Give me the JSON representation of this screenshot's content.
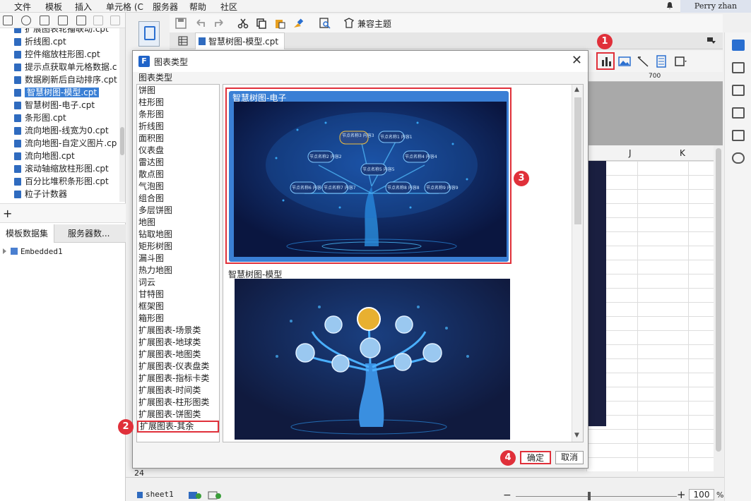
{
  "menubar": {
    "items": [
      "文件",
      "模板",
      "插入",
      "单元格 (C",
      "服务器",
      "帮助",
      "社区"
    ],
    "user": "Perry zhan"
  },
  "left_panel": {
    "files": [
      "扩展图表轮播联动.cpt",
      "折线图.cpt",
      "控件缩放柱形图.cpt",
      "提示点获取单元格数据.c",
      "数据刷新后自动排序.cpt",
      "智慧树图-模型.cpt",
      "智慧树图-电子.cpt",
      "条形图.cpt",
      "流向地图-线宽为0.cpt",
      "流向地图-自定义图片.cp",
      "流向地图.cpt",
      "滚动轴缩放柱形图.cpt",
      "百分比堆积条形图.cpt",
      "粒子计数器"
    ],
    "selected_file": "智慧树图-模型.cpt",
    "tabs": [
      "模板数据集",
      "服务器数..."
    ],
    "dataset": "Embedded1"
  },
  "toolbar": {
    "theme_label": "兼容主题"
  },
  "file_tab": "智慧树图-模型.cpt",
  "ruler_mark": "700",
  "columns": [
    "J",
    "K"
  ],
  "row_number": "24",
  "sheet_tab": "sheet1",
  "zoom": {
    "value": "100",
    "unit": "%"
  },
  "dialog": {
    "title": "图表类型",
    "section_label": "图表类型",
    "categories": [
      "饼图",
      "柱形图",
      "条形图",
      "折线图",
      "面积图",
      "仪表盘",
      "雷达图",
      "散点图",
      "气泡图",
      "组合图",
      "多层饼图",
      "地图",
      "钻取地图",
      "矩形树图",
      "漏斗图",
      "热力地图",
      "词云",
      "甘特图",
      "框架图",
      "箱形图",
      "扩展图表-场景类",
      "扩展图表-地球类",
      "扩展图表-地图类",
      "扩展图表-仪表盘类",
      "扩展图表-指标卡类",
      "扩展图表-时间类",
      "扩展图表-柱形图类",
      "扩展图表-饼图类",
      "扩展图表-其余"
    ],
    "selected_category": "扩展图表-其余",
    "previews": [
      {
        "title": "智慧树图-电子",
        "selected": true
      },
      {
        "title": "智慧树图-模型",
        "selected": false
      }
    ],
    "tree1_labels": [
      "节点名称3 内容3",
      "节点名称1 内容1",
      "节点名称2 内容2",
      "节点名称4 内容4",
      "节点名称5 内容5",
      "节点名称6 内容6",
      "节点名称7 内容7",
      "节点名称8 内容8",
      "节点名称9 内容9"
    ],
    "ok_label": "确定",
    "cancel_label": "取消"
  },
  "annotations": [
    "1",
    "2",
    "3",
    "4"
  ],
  "colors": {
    "accent": "#3a7fd5",
    "highlight": "#e0303a",
    "preview_bg": "#0a1640"
  }
}
